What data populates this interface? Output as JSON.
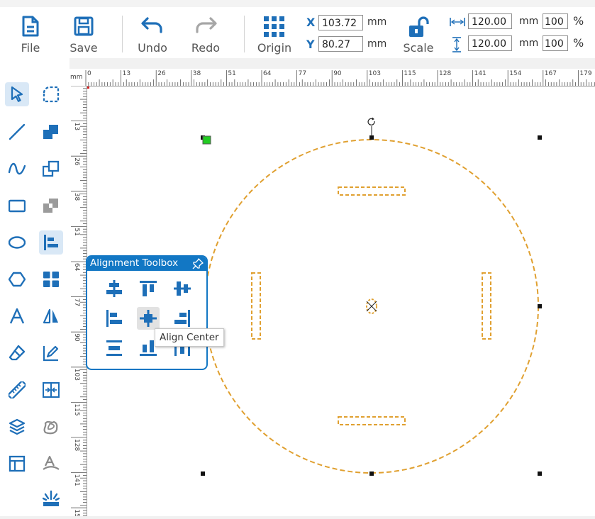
{
  "toolbar": {
    "file": "File",
    "save": "Save",
    "undo": "Undo",
    "redo": "Redo",
    "origin": "Origin",
    "scale": "Scale"
  },
  "position": {
    "x_label": "X",
    "x_value": "103.72",
    "y_label": "Y",
    "y_value": "80.27",
    "unit": "mm"
  },
  "size": {
    "width_value": "120.00",
    "height_value": "120.00",
    "unit": "mm",
    "width_percent": "100",
    "height_percent": "100",
    "percent_sign": "%"
  },
  "ruler": {
    "unit": "mm",
    "h_labels": [
      "0",
      "13",
      "26",
      "38",
      "51",
      "64",
      "77",
      "90",
      "103",
      "115",
      "128",
      "141",
      "154",
      "167",
      "179"
    ],
    "v_labels": [
      "13",
      "26",
      "38",
      "51",
      "64",
      "77",
      "90",
      "103",
      "115",
      "128",
      "141",
      "154"
    ]
  },
  "alignment_toolbox": {
    "title": "Alignment Toolbox",
    "tooltip": "Align Center"
  },
  "colors": {
    "accent": "#1277c4",
    "shape_stroke": "#e0a030",
    "handle": "#000000",
    "origin_marker": "#22cc22"
  }
}
